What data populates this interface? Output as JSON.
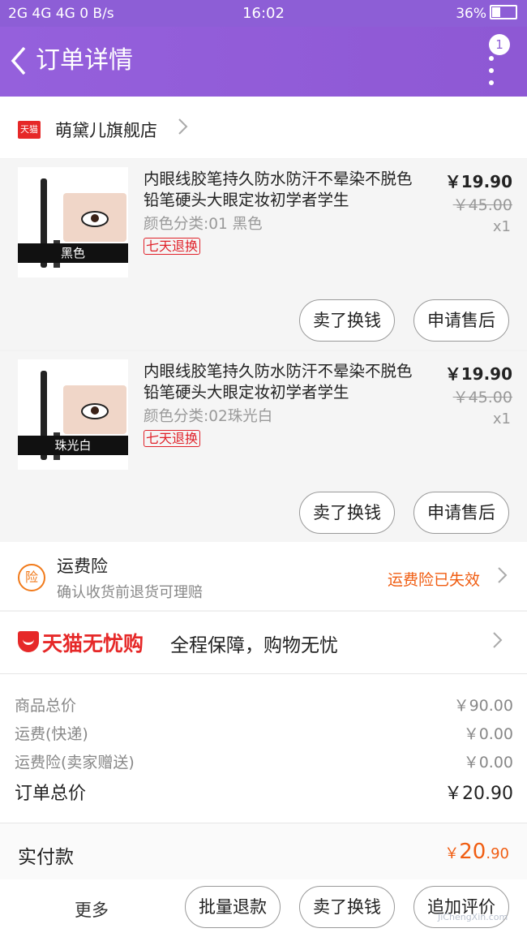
{
  "status_bar": {
    "signal": "2G 4G 4G",
    "network_speed": "0 B/s",
    "time": "16:02",
    "battery": "36%"
  },
  "header": {
    "back_icon": "chevron-left-icon",
    "title": "订单详情",
    "more_icon": "more-vertical-icon",
    "badge_count": "1"
  },
  "store": {
    "badge_icon": "tmall-icon",
    "badge_text": "天猫",
    "name": "萌黛儿旗舰店"
  },
  "items": [
    {
      "title": "内眼线胶笔持久防水防汗不晕染不脱色铅笔硬头大眼定妆初学者学生",
      "sku": "颜色分类:01 黑色",
      "thumb_caption": "黑色",
      "tag": "七天退换",
      "price": "￥19.90",
      "original_price": "￥45.00",
      "quantity": "x1",
      "actions": [
        "卖了换钱",
        "申请售后"
      ]
    },
    {
      "title": "内眼线胶笔持久防水防汗不晕染不脱色铅笔硬头大眼定妆初学者学生",
      "sku": "颜色分类:02珠光白",
      "thumb_caption": "珠光白",
      "tag": "七天退换",
      "price": "￥19.90",
      "original_price": "￥45.00",
      "quantity": "x1",
      "actions": [
        "卖了换钱",
        "申请售后"
      ]
    }
  ],
  "insurance": {
    "icon_text": "险",
    "title": "运费险",
    "subtitle": "确认收货前退货可理赔",
    "status": "运费险已失效"
  },
  "worry_free": {
    "brand": "天猫无忧购",
    "text": "全程保障，购物无忧"
  },
  "summary": {
    "rows": [
      {
        "label": "商品总价",
        "value": "￥90.00"
      },
      {
        "label": "运费(快递)",
        "value": "￥0.00"
      },
      {
        "label": "运费险(卖家赠送)",
        "value": "￥0.00"
      }
    ],
    "total_label": "订单总价",
    "total_value": "￥20.90"
  },
  "paid": {
    "label": "实付款",
    "symbol": "￥",
    "amount_int": "20",
    "amount_dec": ".90"
  },
  "bottom_actions": {
    "more": "更多",
    "buttons": [
      "批量退款",
      "卖了换钱",
      "追加评价"
    ]
  },
  "watermark": "JiChengXin.com",
  "colors": {
    "header_bg": "#8d5ed6",
    "accent_orange": "#f05d12",
    "tmall_red": "#e62828"
  }
}
